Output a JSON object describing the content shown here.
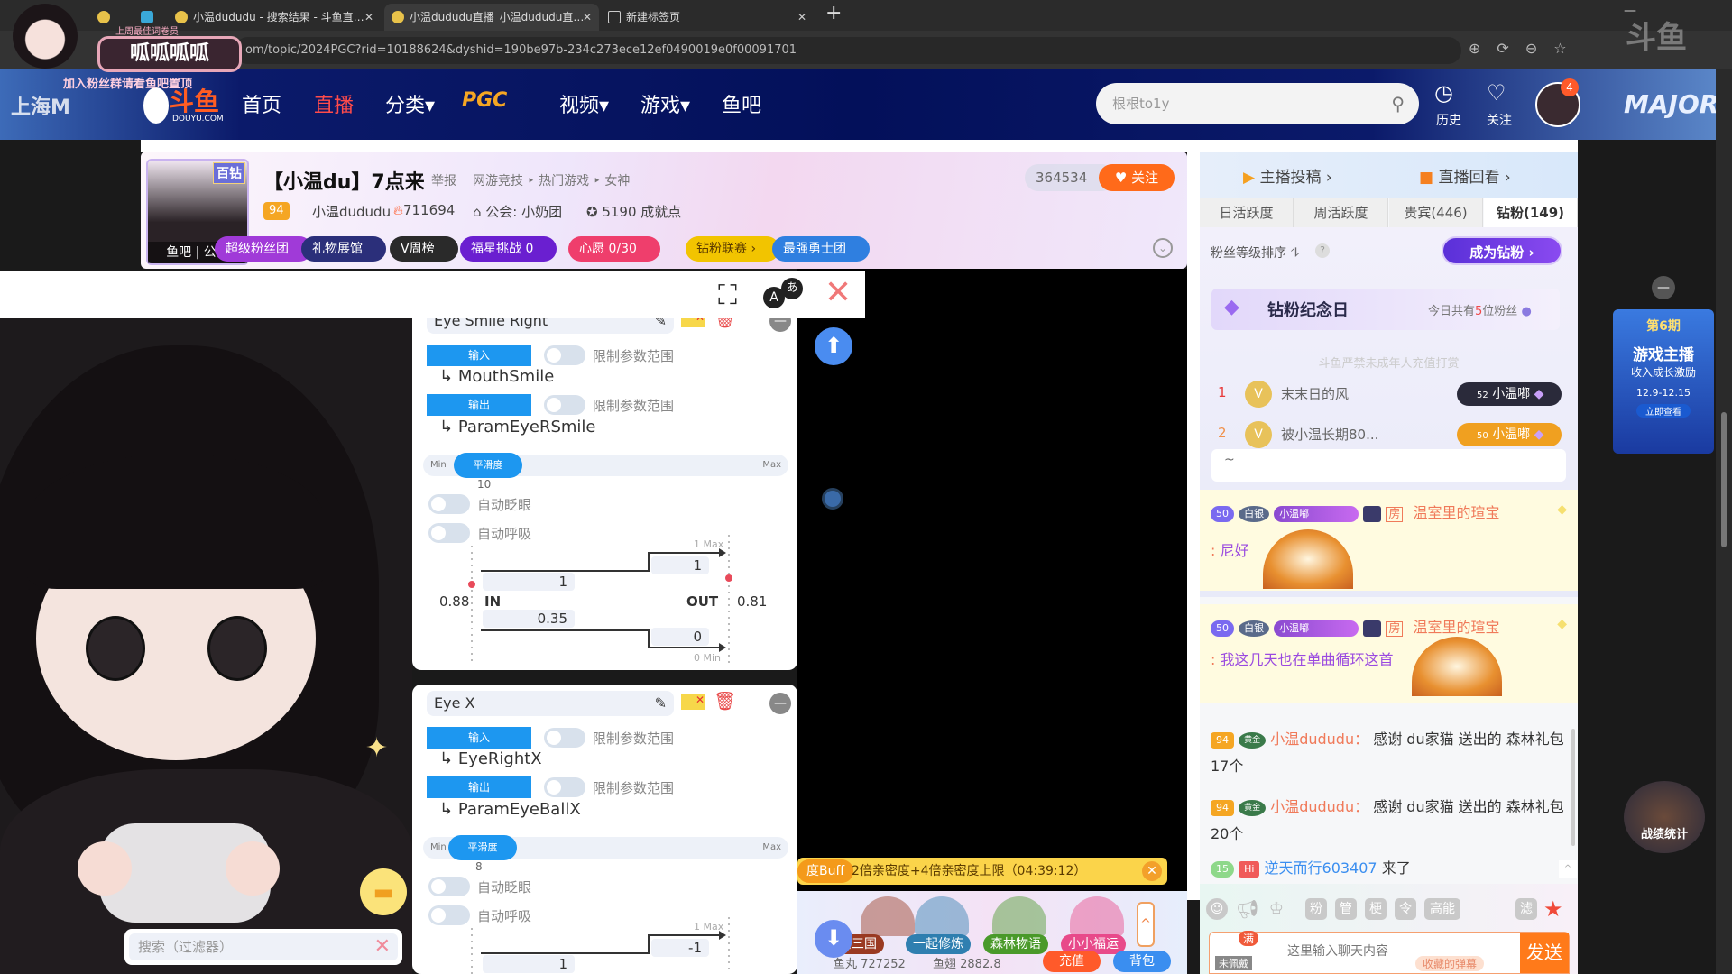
{
  "browser": {
    "tabs": [
      {
        "label": "",
        "active": false
      },
      {
        "label": "",
        "active": false
      },
      {
        "label": "小温dududu - 搜索结果 - 斗鱼直…",
        "active": false
      },
      {
        "label": "小温dududu直播_小温dududu直…",
        "active": true
      },
      {
        "label": "新建标签页",
        "active": false
      }
    ],
    "new_tab": "+",
    "url": "om/topic/2024PGC?rid=10188624&dyshid=190be97b-234c273ece12ef0490019e0f00091701"
  },
  "overlay": {
    "title": "呱呱呱呱",
    "subtitle": "上周最佳词卷员",
    "notice": "加入粉丝群请看鱼吧置顶"
  },
  "nav": {
    "banner_left": "上海M",
    "logo": "斗鱼",
    "logo_sub": "DOUYU.COM",
    "items": [
      {
        "label": "首页",
        "active": false
      },
      {
        "label": "直播",
        "active": true
      },
      {
        "label": "分类▾",
        "active": false
      },
      {
        "label": "PGC",
        "active": false
      },
      {
        "label": "视频▾",
        "active": false
      },
      {
        "label": "游戏▾",
        "active": false
      },
      {
        "label": "鱼吧",
        "active": false
      }
    ],
    "search_placeholder": "根根to1y",
    "history": "历史",
    "follow": "关注",
    "notif_count": "4",
    "banner_right": "MAJOR"
  },
  "room": {
    "title": "【小温du】7点来",
    "report": "举报",
    "categories": "网游竞技 ‣ 热门游戏 ‣ 女神",
    "level": "94",
    "name": "小温dududu",
    "hot": "711694",
    "guild": "公会: 小奶团",
    "achievement": "5190 成就点",
    "followers": "364534",
    "follow_btn": "♥ 关注",
    "avatar_badge": "百钻",
    "avatar_links": "鱼吧 | 公告",
    "pills": [
      {
        "label": "超级粉丝团",
        "color": "#a03ad8"
      },
      {
        "label": "礼物展馆",
        "color": "#2b2f7a"
      },
      {
        "label": "V周榜",
        "color": "#2a2a2a"
      },
      {
        "label": "福星挑战  0",
        "color": "#6a1fd0"
      },
      {
        "label": "心愿    0/30",
        "color": "#ef3e6c"
      },
      {
        "label": "钻粉联赛 ›",
        "color": "#f2c400"
      },
      {
        "label": "最强勇士团",
        "color": "#2f7fe0"
      }
    ]
  },
  "panels": [
    {
      "title": "Eye Smile Right",
      "input_label": "输入",
      "input_param": "MouthSmile",
      "output_label": "输出",
      "output_param": "ParamEyeRSmile",
      "limit_label": "限制参数范围",
      "slider_min": "Min",
      "slider_label": "平滑度",
      "slider_max": "Max",
      "smoothing": "10",
      "auto_blink": "自动眨眼",
      "auto_breath": "自动呼吸",
      "graph": {
        "max_label": "1 Max",
        "min_label": "0 Min",
        "in_label": "IN",
        "out_label": "OUT",
        "in_value": "0.88",
        "out_value": "0.81",
        "in_max": "1",
        "in_min": "0.35",
        "out_max": "1",
        "out_min": "0"
      }
    },
    {
      "title": "Eye X",
      "input_label": "输入",
      "input_param": "EyeRightX",
      "output_label": "输出",
      "output_param": "ParamEyeBallX",
      "limit_label": "限制参数范围",
      "slider_min": "Min",
      "slider_label": "平滑度",
      "slider_max": "Max",
      "smoothing": "8",
      "auto_blink": "自动眨眼",
      "auto_breath": "自动呼吸",
      "graph": {
        "max_label": "1 Max",
        "in_max": "1",
        "out_max": "-1"
      }
    }
  ],
  "filter": {
    "placeholder": "搜索（过滤器）"
  },
  "video": {
    "buff_tag": "度Buff",
    "buff_text": "2倍亲密度+4倍亲密度上限（04:39:12）",
    "gifts": [
      {
        "label": "话三国",
        "color": "#9a3a22"
      },
      {
        "label": "一起修炼",
        "color": "#2f7fb0"
      },
      {
        "label": "森林物语",
        "color": "#4a9a2a"
      },
      {
        "label": "小小福运",
        "color": "#e84a8a"
      }
    ],
    "yuwan": "鱼丸 727252",
    "yuchi": "鱼翅 2882.8",
    "recharge": "充值",
    "backpack": "背包"
  },
  "sidebar": {
    "links": [
      "主播投稿 ›",
      "直播回看 ›"
    ],
    "tabs": [
      {
        "label": "日活跃度",
        "active": false
      },
      {
        "label": "周活跃度",
        "active": false
      },
      {
        "label": "贵宾(446)",
        "active": false
      },
      {
        "label": "钻粉(149)",
        "active": true
      }
    ],
    "sort_label": "粉丝等级排序 ⥮",
    "become_btn": "成为钻粉 ›",
    "anniv_title": "钻粉纪念日",
    "anniv_prefix": "今日共有",
    "anniv_count": "5",
    "anniv_suffix": "位粉丝",
    "watermark": "斗鱼严禁未成年人充值打赏",
    "ranks": [
      {
        "rank": "1",
        "name": "末末日的风",
        "level": "52",
        "badge": "小温嘟"
      },
      {
        "rank": "2",
        "name": "被小温长期80...",
        "level": "50",
        "badge": "小温嘟"
      }
    ],
    "note": "~",
    "messages": [
      {
        "level": "50",
        "tier": "白银",
        "fan": "小温嘟",
        "room": "房",
        "user": "温室里的瑄宝",
        "text": "尼好"
      },
      {
        "level": "50",
        "tier": "白银",
        "fan": "小温嘟",
        "room": "房",
        "user": "温室里的瑄宝",
        "text": "我这几天也在单曲循环这首"
      }
    ],
    "gift_msgs": [
      {
        "level": "94",
        "tier": "黄金",
        "user": "小温dududu：",
        "text": "感谢 du家猫 送出的 森林礼包 17个"
      },
      {
        "level": "94",
        "tier": "黄金",
        "user": "小温dududu：",
        "text": "感谢 du家猫 送出的 森林礼包 20个"
      }
    ],
    "enter": {
      "level": "15",
      "tag": "Hi",
      "user": "逆天而行603407",
      "text": " 来了"
    },
    "tools": [
      "粉",
      "管",
      "梗",
      "令",
      "高能",
      "滤"
    ],
    "badge_full": "满",
    "badge_wear": "未佩戴",
    "chat_placeholder": "这里输入聊天内容",
    "saved": "收藏的弹幕",
    "send": "发送"
  },
  "ad": {
    "title": "第6期",
    "line1": "游戏主播",
    "line2": "收入成长激励",
    "dates": "12.9-12.15",
    "cta": "立即查看",
    "stats": "战绩统计"
  }
}
